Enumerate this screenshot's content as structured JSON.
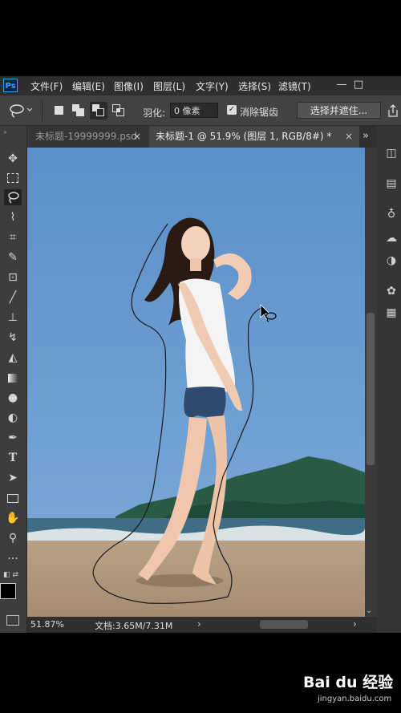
{
  "app": {
    "logo": "Ps"
  },
  "menu": [
    "文件(F)",
    "编辑(E)",
    "图像(I)",
    "图层(L)",
    "文字(Y)",
    "选择(S)",
    "滤镜(T)"
  ],
  "window_buttons": {
    "minimize": "—",
    "restore": "□"
  },
  "options": {
    "feather_label": "羽化:",
    "feather_value": "0 像素",
    "antialias_checked": "✓",
    "antialias_label": "消除锯齿",
    "select_mask_label": "选择并遮住..."
  },
  "tabs": [
    {
      "label": "未标题-19999999.psd",
      "close": "×"
    },
    {
      "label": "未标题-1 @ 51.9% (图层 1, RGB/8#) *",
      "close": "×"
    }
  ],
  "tab_overflow": "»",
  "status": {
    "zoom": "51.87%",
    "doc": "文档:3.65M/7.31M",
    "arrow": "›"
  },
  "watermark": {
    "main": "Bai du 经验",
    "sub": "jingyan.baidu.com"
  },
  "colors": {
    "menubar": "#2e2e2e",
    "panel": "#424242",
    "accent": "#31a8ff",
    "sky": "#5d90c6"
  },
  "icons": {
    "tools": [
      "move-icon",
      "marquee-icon",
      "lasso-icon",
      "quick-select-icon",
      "crop-icon",
      "eyedropper-icon",
      "healing-icon",
      "brush-icon",
      "stamp-icon",
      "history-brush-icon",
      "eraser-icon",
      "gradient-icon",
      "blur-icon",
      "dodge-icon",
      "pen-icon",
      "type-icon",
      "path-select-icon",
      "rectangle-icon",
      "hand-icon",
      "zoom-icon",
      "more-icon"
    ],
    "right": [
      "properties-icon",
      "libraries-icon",
      "adjustments-icon",
      "cc-libraries-icon",
      "styles-icon",
      "color-icon",
      "swatches-icon"
    ]
  }
}
